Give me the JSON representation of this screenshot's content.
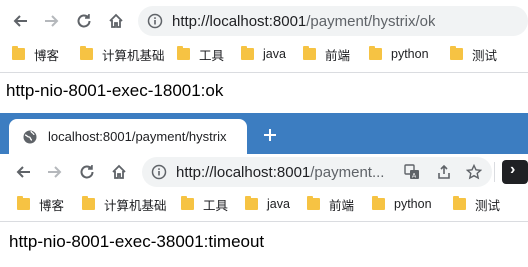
{
  "window1": {
    "url_host": "http://localhost:8001",
    "url_path": "/payment/hystrix/ok",
    "bookmarks": [
      "博客",
      "计算机基础",
      "工具",
      "java",
      "前端",
      "python",
      "测试"
    ],
    "page_text": "http-nio-8001-exec-18001:ok"
  },
  "window2": {
    "tab_title": "localhost:8001/payment/hystrix",
    "url_host": "http://localhost:8001",
    "url_path": "/payment...",
    "bookmarks": [
      "博客",
      "计算机基础",
      "工具",
      "java",
      "前端",
      "python",
      "测试"
    ],
    "page_text": "http-nio-8001-exec-38001:timeout"
  },
  "icons": [
    "back-icon",
    "forward-icon",
    "reload-icon",
    "home-icon",
    "info-icon",
    "translate-icon",
    "share-icon",
    "star-icon",
    "extension-icon",
    "globe-icon",
    "plus-icon",
    "folder-icon"
  ],
  "colors": {
    "tabstrip": "#3c7dc1",
    "omnibox": "#f1f3f4",
    "folder": "#f6c343"
  }
}
